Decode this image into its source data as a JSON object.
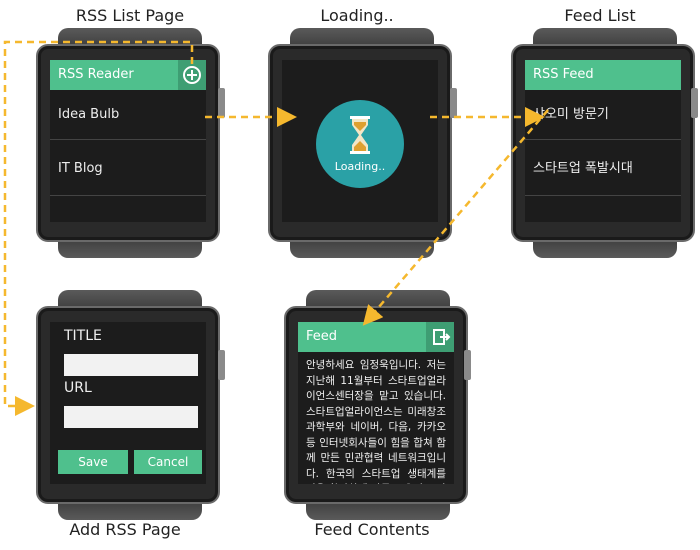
{
  "captions": {
    "rss_list_page": "RSS List Page",
    "loading": "Loading..",
    "feed_list": "Feed List",
    "add_rss_page": "Add RSS Page",
    "feed_contents": "Feed Contents"
  },
  "rss_list": {
    "header": "RSS Reader",
    "items": [
      "Idea Bulb",
      "IT Blog"
    ]
  },
  "loading_screen": {
    "label": "Loading.."
  },
  "feed_list": {
    "header": "RSS Feed",
    "items": [
      "샤오미 방문기",
      "스타트업 폭발시대"
    ]
  },
  "add_rss": {
    "title_label": "TITLE",
    "url_label": "URL",
    "save_label": "Save",
    "cancel_label": "Cancel"
  },
  "feed_contents": {
    "header": "Feed",
    "body": "안녕하세요 임정욱입니다. 저는 지난해 11월부터 스타트업얼라이언스센터장을 맡고 있습니다. 스타트업얼라이언스는 미래창조과학부와 네이버, 다음, 카카오 등 인터넷회사들이 힘을 합쳐 함께 만든 민관협력 네트워크입니다. 한국의 스타트업 생태계를 더욱 활발하게 만들고 우리 스타트업의 해외"
  },
  "colors": {
    "accent": "#4fc08d",
    "arrow": "#f5b82e",
    "loading_circle": "#2aa1a6"
  }
}
